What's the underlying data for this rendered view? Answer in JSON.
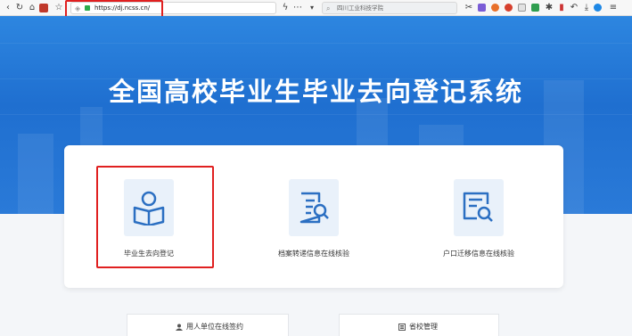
{
  "browser": {
    "url": "https://dj.ncss.cn/",
    "search_placeholder": "四川工业科技学院"
  },
  "page": {
    "banner_title": "全国高校毕业生毕业去向登记系统",
    "features": [
      {
        "label": "毕业生去向登记",
        "icon": "reader-icon"
      },
      {
        "label": "档案转递信息在线核验",
        "icon": "document-search-icon"
      },
      {
        "label": "户口迁移信息在线核验",
        "icon": "list-search-icon"
      }
    ],
    "bottom_buttons": [
      {
        "label": "用人单位在线签约",
        "icon": "user-icon"
      },
      {
        "label": "省校管理",
        "icon": "building-icon"
      }
    ]
  },
  "colors": {
    "banner": "#2278d6",
    "icon_blue": "#2b6fc2",
    "highlight_red": "#e02020"
  }
}
